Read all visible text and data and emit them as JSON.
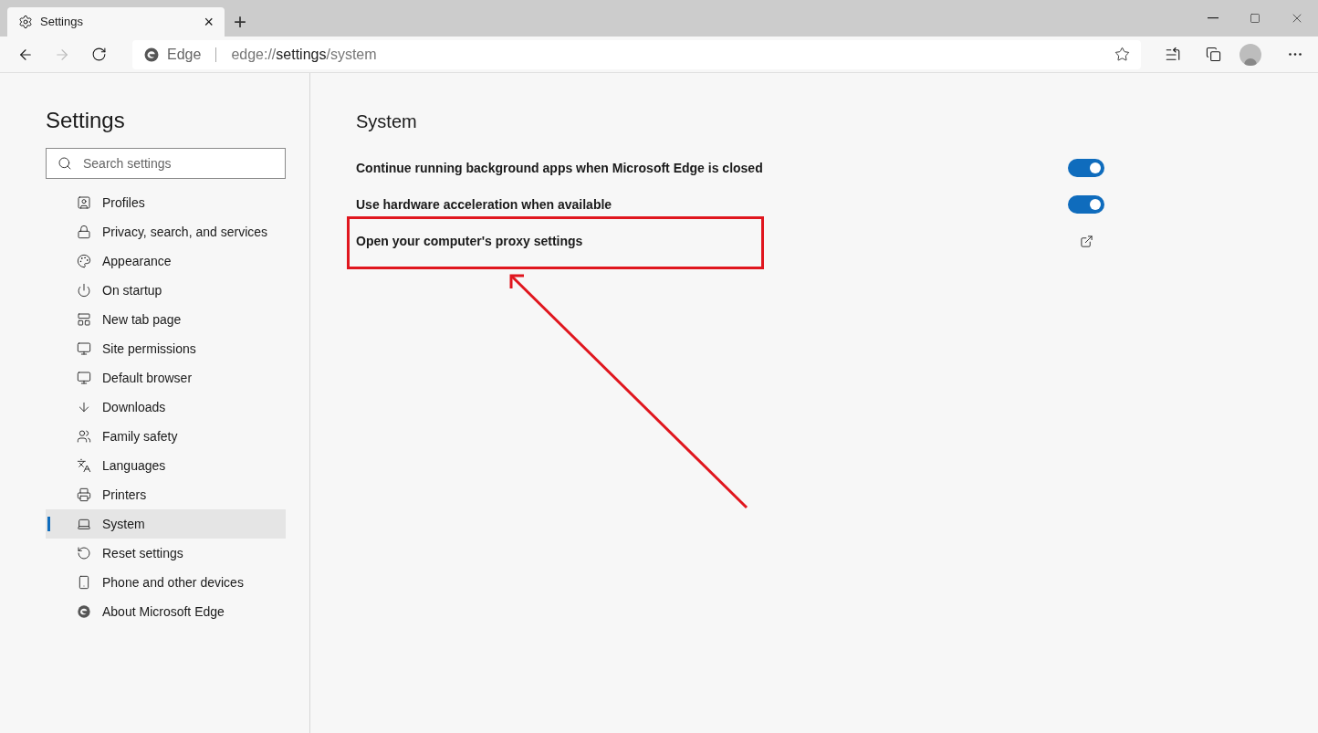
{
  "tab": {
    "title": "Settings",
    "close": "×",
    "new_tab": "+"
  },
  "address_bar": {
    "site": "Edge",
    "url_prefix": "edge://",
    "url_host": "settings",
    "url_path": "/system"
  },
  "sidebar": {
    "title": "Settings",
    "search": {
      "placeholder": "Search settings"
    },
    "items": [
      {
        "label": "Profiles",
        "selected": false
      },
      {
        "label": "Privacy, search, and services",
        "selected": false
      },
      {
        "label": "Appearance",
        "selected": false
      },
      {
        "label": "On startup",
        "selected": false
      },
      {
        "label": "New tab page",
        "selected": false
      },
      {
        "label": "Site permissions",
        "selected": false
      },
      {
        "label": "Default browser",
        "selected": false
      },
      {
        "label": "Downloads",
        "selected": false
      },
      {
        "label": "Family safety",
        "selected": false
      },
      {
        "label": "Languages",
        "selected": false
      },
      {
        "label": "Printers",
        "selected": false
      },
      {
        "label": "System",
        "selected": true
      },
      {
        "label": "Reset settings",
        "selected": false
      },
      {
        "label": "Phone and other devices",
        "selected": false
      },
      {
        "label": "About Microsoft Edge",
        "selected": false
      }
    ]
  },
  "main": {
    "title": "System",
    "settings": [
      {
        "kind": "toggle",
        "label": "Continue running background apps when Microsoft Edge is closed",
        "on": true
      },
      {
        "kind": "toggle",
        "label": "Use hardware acceleration when available",
        "on": true
      },
      {
        "kind": "link",
        "label": "Open your computer's proxy settings"
      }
    ]
  }
}
